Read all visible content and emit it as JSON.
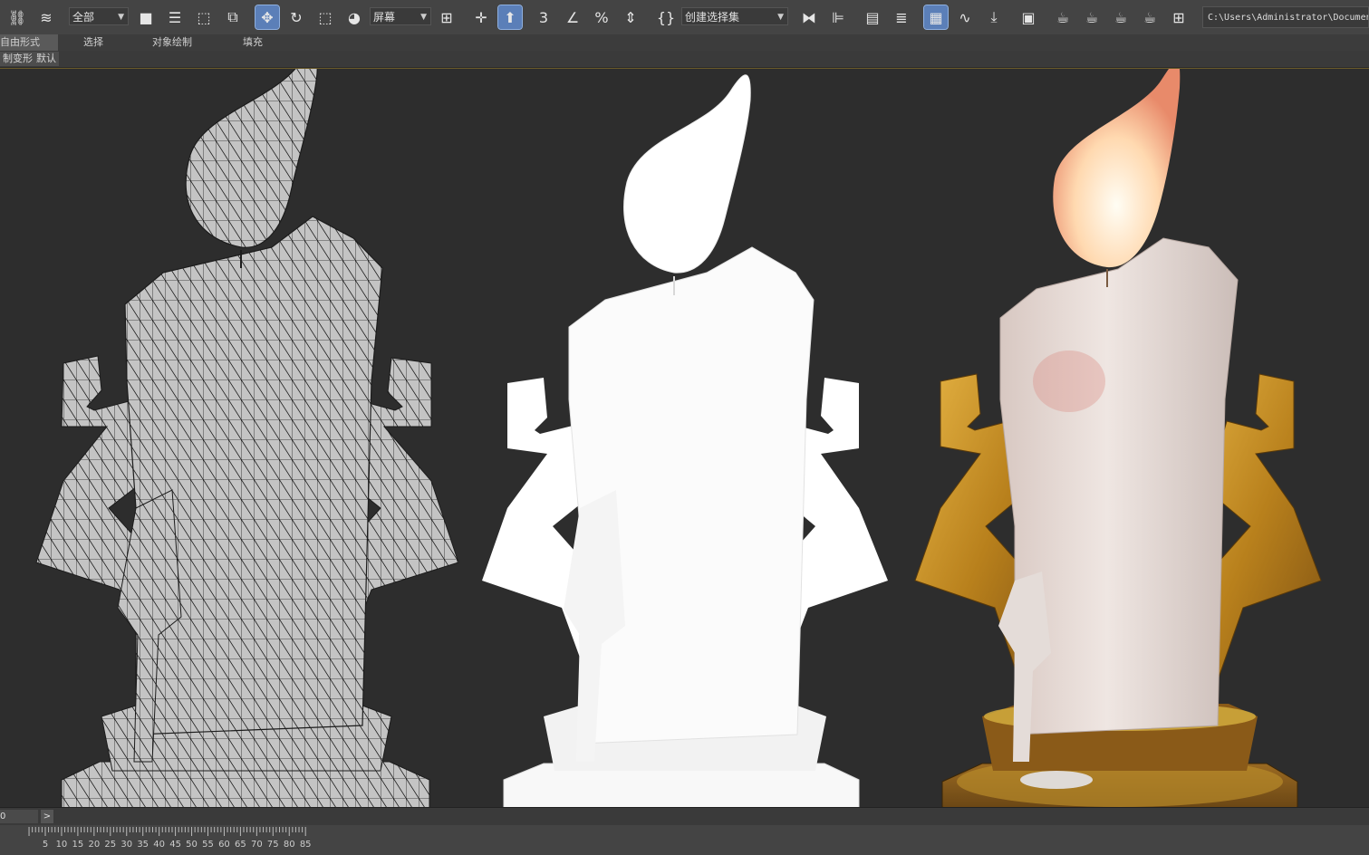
{
  "toolbar": {
    "selection_filter": "全部",
    "reference_coord": "屏幕",
    "named_selection": "创建选择集",
    "path": "C:\\Users\\Administrator\\Documents"
  },
  "ribbon": {
    "tabs": [
      "自由形式",
      "选择",
      "对象绘制",
      "填充"
    ],
    "subitems": [
      "制变形",
      "默认"
    ]
  },
  "timeline": {
    "frame_value": "0",
    "next_symbol": ">"
  },
  "ruler": {
    "ticks": [
      "5",
      "10",
      "15",
      "20",
      "25",
      "30",
      "35",
      "40",
      "45",
      "50",
      "55",
      "60",
      "65",
      "70",
      "75",
      "80",
      "85"
    ]
  },
  "icons": {
    "toolbar_left": [
      "link-icon",
      "bind-space-warp-icon"
    ],
    "toolbar_tools": [
      "select-object-icon",
      "select-by-name-icon",
      "rect-region-icon",
      "window-crossing-icon",
      "move-icon",
      "rotate-icon",
      "scale-icon",
      "place-icon"
    ],
    "toolbar_snaps": [
      "snap-3d-icon",
      "angle-snap-icon",
      "percent-snap-icon",
      "spinner-snap-icon"
    ],
    "toolbar_right": [
      "edit-named-sets-icon",
      "mirror-icon",
      "align-icon",
      "scene-explorer-icon",
      "layer-explorer-icon",
      "toggle-ribbon-icon",
      "curve-editor-icon",
      "schematic-view-icon",
      "material-editor-icon",
      "render-setup-icon",
      "rendered-frame-icon",
      "render-icon",
      "render-iterative-icon",
      "render-cloud-icon",
      "render-grid-icon"
    ]
  },
  "colors": {
    "wire_fill": "#c8c8c8",
    "wire_line": "#1c1c1c",
    "clay": "#f6f6f6",
    "wax": "#e8dcd6",
    "gold": "#c8901e",
    "flame": "#ffe9c8",
    "viewport_bg": "#2d2d2d"
  }
}
